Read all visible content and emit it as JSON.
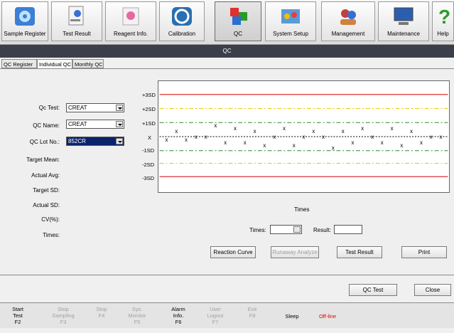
{
  "toolbar": {
    "items": [
      {
        "label": "Sample Register",
        "icon": "gear-icon"
      },
      {
        "label": "Test Result",
        "icon": "test-result-icon"
      },
      {
        "label": "Reagent Info.",
        "icon": "reagent-icon"
      },
      {
        "label": "Calibration",
        "icon": "calibration-icon"
      },
      {
        "label": "QC",
        "icon": "qc-icon"
      },
      {
        "label": "System Setup",
        "icon": "system-setup-icon"
      },
      {
        "label": "Management",
        "icon": "management-icon"
      },
      {
        "label": "Maintenance",
        "icon": "maintenance-icon"
      },
      {
        "label": "Help",
        "icon": "help-icon"
      }
    ]
  },
  "title": "QC",
  "tabs": [
    "QC Register",
    "Individual QC",
    "Monthly QC"
  ],
  "form": {
    "qc_test_label": "Qc Test:",
    "qc_test_value": "CREAT",
    "qc_name_label": "QC Name:",
    "qc_name_value": "CREAT",
    "qc_lot_label": "QC Lot No.:",
    "qc_lot_value": "852CR",
    "target_mean_label": "Target Mean:",
    "actual_avg_label": "Actual Avg:",
    "target_sd_label": "Target SD:",
    "actual_sd_label": "Actual SD:",
    "cv_label": "CV(%):",
    "times_label": "Times:"
  },
  "chart_data": {
    "type": "scatter",
    "levels": [
      "+3SD",
      "+2SD",
      "+1SD",
      "X",
      "-1SD",
      "-2SD",
      "-3SD"
    ],
    "xlabel": "Times",
    "marker": "x",
    "points": [
      0.4,
      0.7,
      0.4,
      0.5,
      0.5,
      0.9,
      0.3,
      0.8,
      0.3,
      0.7,
      0.2,
      0.5,
      0.8,
      0.2,
      0.5,
      0.7,
      0.5,
      0.1,
      0.7,
      0.3,
      0.8,
      0.5,
      0.3,
      0.8,
      0.2,
      0.7,
      0.3,
      0.5,
      0.5
    ],
    "colors": {
      "3sd": "#e03030",
      "2sd": "#e8c800",
      "1sd": "#2a8a2a",
      "mean": "#000000"
    }
  },
  "times_row": {
    "times_label": "Times:",
    "result_label": "Result:"
  },
  "buttons": {
    "reaction_curve": "Reaction Curve",
    "runaway_analyze": "Runaway Analyze",
    "test_result": "Test Result",
    "print": "Print",
    "qc_test": "QC Test",
    "close": "Close"
  },
  "fkeys": [
    {
      "label": "Start\nTest\nF2",
      "enabled": true
    },
    {
      "label": "Stop\nSampling\nF3",
      "enabled": false
    },
    {
      "label": "Stop\nF4",
      "enabled": false
    },
    {
      "label": "Sys.\nMonitor\nF5",
      "enabled": false
    },
    {
      "label": "Alarm\nInfo.\nF6",
      "enabled": true
    },
    {
      "label": "User\nLogout\nF7",
      "enabled": false
    },
    {
      "label": "Exit\nF8",
      "enabled": false
    },
    {
      "label": "Sleep",
      "enabled": true
    },
    {
      "label": "Off-line",
      "enabled": true
    }
  ],
  "colors": {
    "title_bg": "#3a3f4a",
    "offline": "#e00000"
  }
}
